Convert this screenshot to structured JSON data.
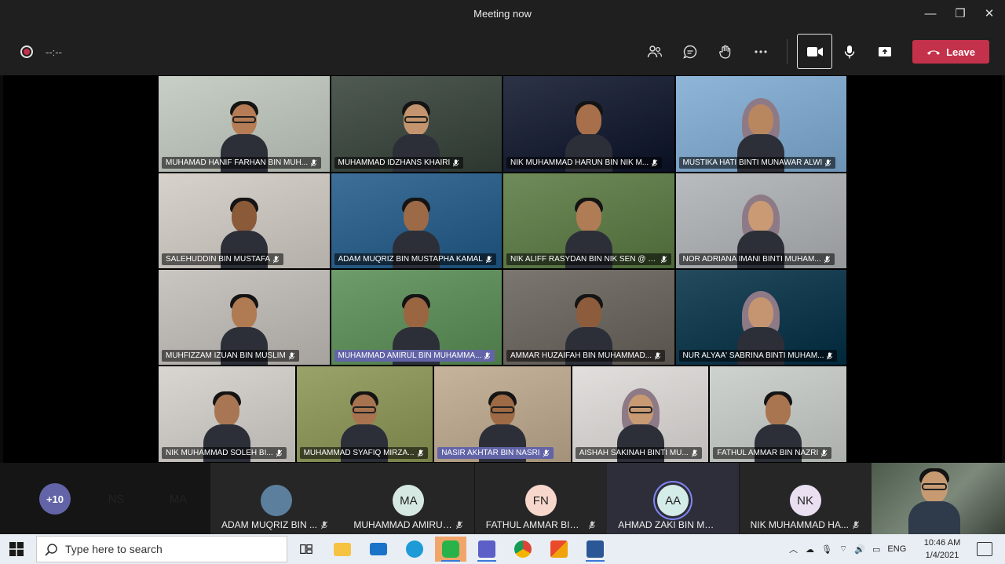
{
  "window": {
    "title": "Meeting now"
  },
  "toolbar": {
    "timer": "--:--",
    "leave_label": "Leave"
  },
  "participants": [
    {
      "name": "MUHAMAD HANIF FARHAN BIN MUH...",
      "bg": "#c8cfc7",
      "tone": "#b57c55",
      "glasses": true,
      "hijab": false,
      "active": false
    },
    {
      "name": "MUHAMMAD IDZHANS KHAIRI",
      "bg": "#4f5a52",
      "tone": "#c3946d",
      "glasses": true,
      "hijab": false,
      "active": false
    },
    {
      "name": "NIK MUHAMMAD HARUN BIN NIK M...",
      "bg": "#2d3346",
      "tone": "#a8704a",
      "glasses": false,
      "hijab": false,
      "active": false
    },
    {
      "name": "MUSTIKA HATI BINTI MUNAWAR ALWI",
      "bg": "#8fb6d9",
      "tone": "#b9875f",
      "glasses": false,
      "hijab": true,
      "active": false
    },
    {
      "name": "SALEHUDDIN BIN MUSTAFA",
      "bg": "#d7d2cc",
      "tone": "#8b5a39",
      "glasses": false,
      "hijab": false,
      "active": false
    },
    {
      "name": "ADAM MUQRIZ BIN MUSTAPHA KAMAL",
      "bg": "#3d6f98",
      "tone": "#9c6a46",
      "glasses": false,
      "hijab": false,
      "active": false
    },
    {
      "name": "NIK ALIFF RASYDAN BIN NIK SEN @ N...",
      "bg": "#6f8b5a",
      "tone": "#b07c55",
      "glasses": false,
      "hijab": false,
      "active": false
    },
    {
      "name": "NOR ADRIANA IMANI BINTI MUHAM...",
      "bg": "#b8bcbf",
      "tone": "#c99a74",
      "glasses": false,
      "hijab": true,
      "active": false
    },
    {
      "name": "MUHFIZZAM IZUAN  BIN MUSLIM",
      "bg": "#c9c5c1",
      "tone": "#b07a52",
      "glasses": false,
      "hijab": false,
      "active": false
    },
    {
      "name": "MUHAMMAD AMIRUL BIN MUHAMMA...",
      "bg": "#6f9c6b",
      "tone": "#9a6541",
      "glasses": false,
      "hijab": false,
      "active": true
    },
    {
      "name": "AMMAR HUZAIFAH BIN MUHAMMAD...",
      "bg": "#7c7670",
      "tone": "#8d5c3c",
      "glasses": false,
      "hijab": false,
      "active": false
    },
    {
      "name": "NUR ALYAA' SABRINA BINTI MUHAM...",
      "bg": "#244a5e",
      "tone": "#c49570",
      "glasses": false,
      "hijab": true,
      "active": false
    },
    {
      "name": "NIK MUHAMMAD SOLEH BI...",
      "bg": "#d9d6d2",
      "tone": "#a87652",
      "glasses": false,
      "hijab": false,
      "active": false
    },
    {
      "name": "MUHAMMAD SYAFIQ MIRZA...",
      "bg": "#9aa36a",
      "tone": "#a87450",
      "glasses": true,
      "hijab": false,
      "active": false
    },
    {
      "name": "NASIR AKHTAR BIN NASRI",
      "bg": "#c7b49c",
      "tone": "#9d6a45",
      "glasses": true,
      "hijab": false,
      "active": true
    },
    {
      "name": "AISHAH SAKINAH BINTI MU...",
      "bg": "#e2dfdd",
      "tone": "#c89a74",
      "glasses": true,
      "hijab": true,
      "active": false
    },
    {
      "name": "FATHUL AMMAR BIN NAZRI",
      "bg": "#cfd3cf",
      "tone": "#a97550",
      "glasses": false,
      "hijab": false,
      "active": false
    }
  ],
  "roster": {
    "more_label": "+10",
    "initials": [
      {
        "text": "NS",
        "color": "#c8d4ea"
      },
      {
        "text": "MA",
        "color": "#dcd0ee"
      }
    ],
    "cards": [
      {
        "initials": "",
        "name": "ADAM MUQRIZ BIN ...",
        "color": "#5d7f9e",
        "photo": true
      },
      {
        "initials": "MA",
        "name": "MUHAMMAD AMIRUL BI...",
        "color": "#d6e8e2",
        "photo": false
      },
      {
        "initials": "FN",
        "name": "FATHUL AMMAR BIN ...",
        "color": "#f7d7cc",
        "photo": false
      },
      {
        "initials": "AA",
        "name": "AHMAD ZAKI BIN MOHA...",
        "color": "#d4ece8",
        "photo": false,
        "speaking": true
      },
      {
        "initials": "NK",
        "name": "NIK MUHAMMAD HA...",
        "color": "#e9dff0",
        "photo": false
      }
    ]
  },
  "taskbar": {
    "search_placeholder": "Type here to search",
    "language": "ENG",
    "time": "10:46 AM",
    "date": "1/4/2021"
  },
  "colors": {
    "accent": "#6264a7",
    "leave": "#c4314b",
    "titlebar": "#1f1f1f"
  }
}
